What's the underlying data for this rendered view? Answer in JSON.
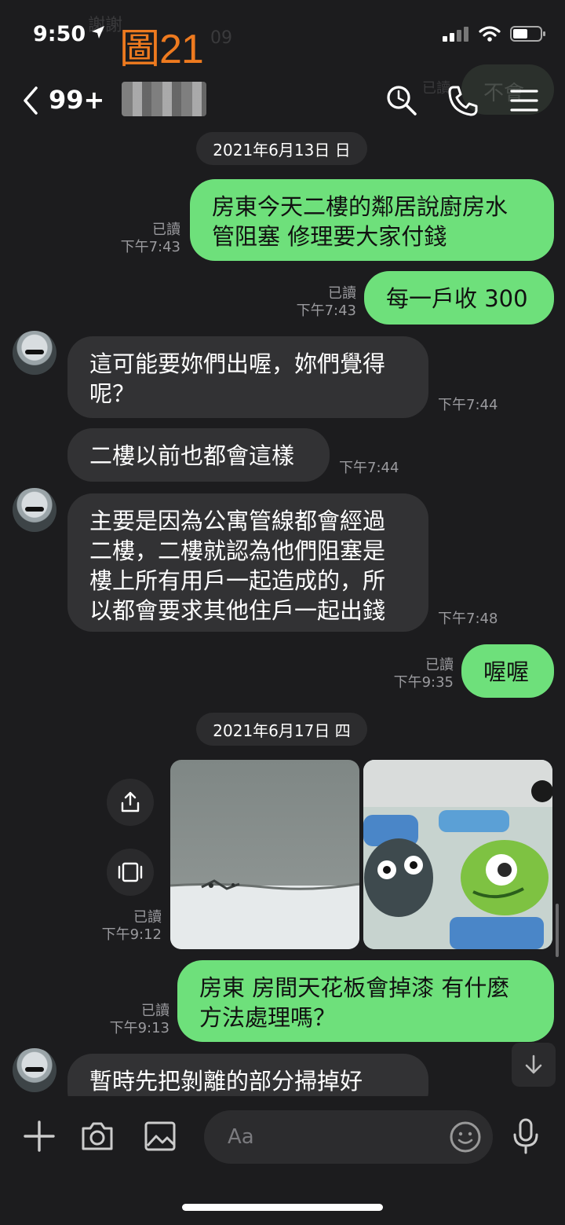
{
  "status": {
    "time": "9:50",
    "annotation": "圖21",
    "faded_prev_text": "謝謝",
    "faded_prev_time": "09",
    "faded_prev_read": "已讀",
    "faded_prev_reply": "不會"
  },
  "nav": {
    "back_count": "99+",
    "icons": [
      "search-icon",
      "phone-icon",
      "menu-icon"
    ]
  },
  "dates": [
    "2021年6月13日 日",
    "2021年6月17日 四"
  ],
  "messages": [
    {
      "dir": "out",
      "text": [
        "房東今天二樓的鄰居說廚房水",
        "管阻塞 修理要大家付錢"
      ],
      "read": "已讀",
      "time": "下午7:43"
    },
    {
      "dir": "out",
      "text": [
        "每一戶收 300"
      ],
      "read": "已讀",
      "time": "下午7:43"
    },
    {
      "dir": "in",
      "text": [
        "這可能要妳們出喔，妳們覺得",
        "呢？"
      ],
      "time": "下午7:44"
    },
    {
      "dir": "in",
      "text": [
        "二樓以前也都會這樣"
      ],
      "time": "下午7:44"
    },
    {
      "dir": "in",
      "text": [
        "主要是因為公寓管線都會經過",
        "二樓，二樓就認為他們阻塞是",
        "樓上所有用戶一起造成的，所",
        "以都會要求其他住戶一起出錢"
      ],
      "time": "下午7:48"
    },
    {
      "dir": "out",
      "text": [
        "喔喔"
      ],
      "read": "已讀",
      "time": "下午9:35"
    },
    {
      "dir": "out",
      "type": "images",
      "read": "已讀",
      "time": "下午9:12"
    },
    {
      "dir": "out",
      "text": [
        "房東 房間天花板會掉漆 有什麼",
        "方法處理嗎？"
      ],
      "read": "已讀",
      "time": "下午9:13"
    },
    {
      "dir": "in",
      "text": [
        "暫時先把剝離的部分掃掉好"
      ]
    }
  ],
  "composer": {
    "placeholder": "Aa"
  },
  "colors": {
    "out_bubble": "#6ee07b",
    "in_bubble": "#323234",
    "background": "#1c1c1e",
    "annotation": "#ee7a1f"
  }
}
